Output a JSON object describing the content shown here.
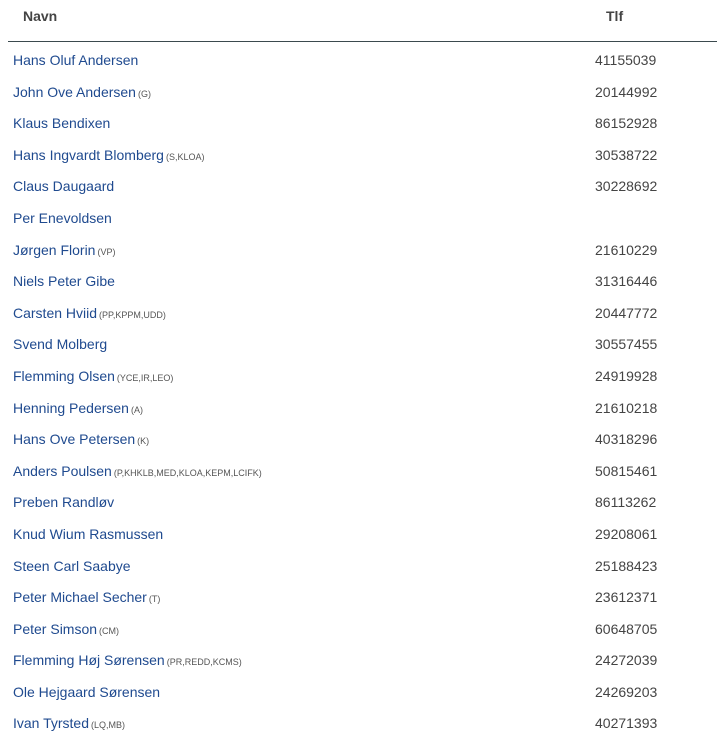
{
  "table": {
    "headers": {
      "name": "Navn",
      "phone": "Tlf"
    },
    "rows": [
      {
        "name": "Hans Oluf Andersen",
        "roles": "",
        "phone": "41155039"
      },
      {
        "name": "John Ove Andersen",
        "roles": "(G)",
        "phone": "20144992"
      },
      {
        "name": "Klaus Bendixen",
        "roles": "",
        "phone": "86152928"
      },
      {
        "name": "Hans Ingvardt Blomberg",
        "roles": "(S,KLOA)",
        "phone": "30538722"
      },
      {
        "name": "Claus Daugaard",
        "roles": "",
        "phone": "30228692"
      },
      {
        "name": "Per Enevoldsen",
        "roles": "",
        "phone": ""
      },
      {
        "name": "Jørgen Florin",
        "roles": "(VP)",
        "phone": "21610229"
      },
      {
        "name": "Niels Peter Gibe",
        "roles": "",
        "phone": "31316446"
      },
      {
        "name": "Carsten Hviid",
        "roles": "(PP,KPPM,UDD)",
        "phone": "20447772"
      },
      {
        "name": "Svend Molberg",
        "roles": "",
        "phone": "30557455"
      },
      {
        "name": "Flemming Olsen",
        "roles": "(YCE,IR,LEO)",
        "phone": "24919928"
      },
      {
        "name": "Henning Pedersen",
        "roles": "(A)",
        "phone": "21610218"
      },
      {
        "name": "Hans Ove Petersen",
        "roles": "(K)",
        "phone": "40318296"
      },
      {
        "name": "Anders Poulsen",
        "roles": "(P,KHKLB,MED,KLOA,KEPM,LCIFK)",
        "phone": "50815461"
      },
      {
        "name": "Preben Randløv",
        "roles": "",
        "phone": "86113262"
      },
      {
        "name": "Knud Wium Rasmussen",
        "roles": "",
        "phone": "29208061"
      },
      {
        "name": "Steen Carl Saabye",
        "roles": "",
        "phone": "25188423"
      },
      {
        "name": "Peter Michael Secher",
        "roles": "(T)",
        "phone": "23612371"
      },
      {
        "name": "Peter Simson",
        "roles": "(CM)",
        "phone": "60648705"
      },
      {
        "name": "Flemming Høj Sørensen",
        "roles": "(PR,REDD,KCMS)",
        "phone": "24272039"
      },
      {
        "name": "Ole Hejgaard Sørensen",
        "roles": "",
        "phone": "24269203"
      },
      {
        "name": "Ivan Tyrsted",
        "roles": "(LQ,MB)",
        "phone": "40271393"
      }
    ]
  }
}
